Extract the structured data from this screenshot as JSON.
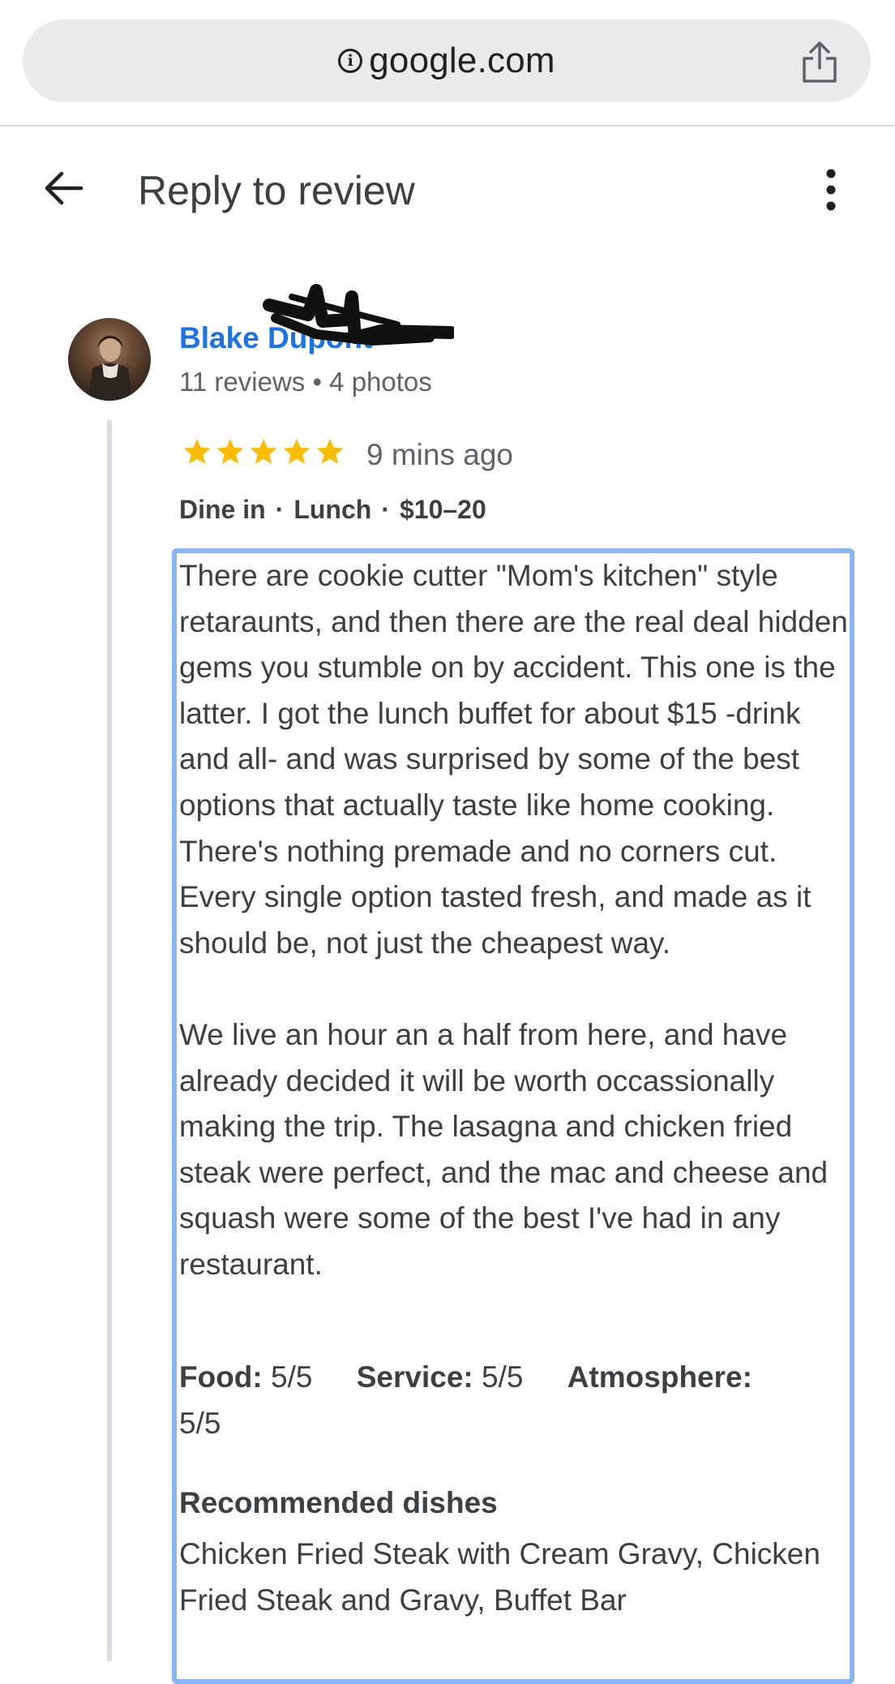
{
  "browser": {
    "url": "google.com",
    "icons": {
      "info": "info-icon",
      "share": "share-icon"
    }
  },
  "header": {
    "title": "Reply to review",
    "icons": {
      "back": "arrow-left-icon",
      "more": "more-vert-icon"
    }
  },
  "reviewer": {
    "name": "Blake Dupont",
    "meta": "11 reviews • 4 photos"
  },
  "review": {
    "rating": 5,
    "max_rating": 5,
    "star_color": "#fbbc04",
    "time_ago": "9 mins ago",
    "dine_mode": "Dine in",
    "meal": "Lunch",
    "price": "$10–20",
    "separator": "·",
    "text": "There are cookie cutter \"Mom's kitchen\" style retaraunts, and then there are the real deal hidden gems you stumble on by accident. This one is the latter. I got the lunch buffet for about $15 -drink and all- and was surprised by some of the best options that actually taste like home cooking. There's nothing premade and no corners cut. Every single option tasted fresh, and made as it should be, not just the cheapest way.\n\nWe live an hour an a half from here, and have already decided it will be worth occassionally making the trip. The lasagna and chicken fried steak were perfect, and the mac and cheese and squash were some of the best I've had in any restaurant.",
    "ratings": [
      {
        "label": "Food",
        "value": "5/5"
      },
      {
        "label": "Service",
        "value": "5/5"
      },
      {
        "label": "Atmosphere",
        "value": "5/5"
      }
    ],
    "recommended_title": "Recommended dishes",
    "recommended_text": "Chicken Fried Steak with Cream Gravy, Chicken Fried Steak and Gravy, Buffet Bar"
  },
  "colors": {
    "link_blue": "#1a73e8",
    "focus_border": "#8ab4f8",
    "text_secondary": "#5f6368"
  }
}
